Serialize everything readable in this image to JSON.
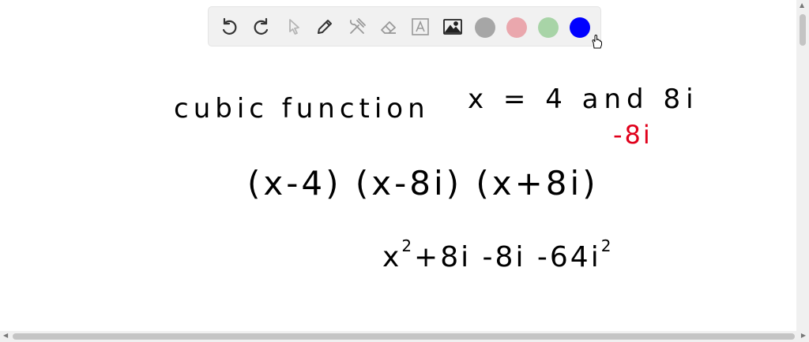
{
  "toolbar": {
    "tools": [
      "undo-icon",
      "redo-icon",
      "select-arrow-icon",
      "pen-icon",
      "tools-icon",
      "eraser-icon",
      "text-box-icon",
      "image-icon"
    ],
    "colors": [
      "#a6a6a6",
      "#eaa7ad",
      "#a8d4a7",
      "#0000ff"
    ],
    "selected_color": "#0000ff"
  },
  "handwriting": {
    "line1_left": "cubic function",
    "line1_right": "x = 4 and 8i",
    "conjugate": "-8i",
    "factored": "(x-4) (x-8i) (x+8i)",
    "expansion_base": "x",
    "expansion_exponent": "2",
    "expansion_mid": "+8i -8i -64i",
    "expansion_exponent2": "2"
  },
  "ink_colors": {
    "black": "#000000",
    "red": "#e0001b"
  }
}
